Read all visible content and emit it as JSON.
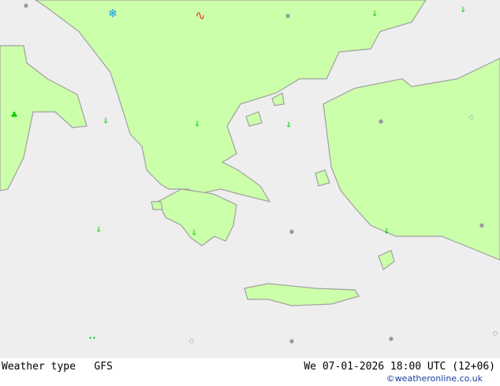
{
  "map": {
    "title": "Weather type",
    "model": "GFS",
    "datetime": "We 07-01-2026 18:00 UTC (12+06)",
    "credit": "©weatheronline.co.uk",
    "colors": {
      "sea": "#eeeeee",
      "land": "#ccffaa",
      "border": "#a0a0a0",
      "rain": "#00cc00",
      "snow": "#1199ee",
      "thunder_warm": "#ee3333",
      "cloud": "#999999"
    },
    "symbols": [
      {
        "type": "snow-icon",
        "glyph": "❄",
        "color": "#1199ee"
      },
      {
        "type": "frontal-wave-icon",
        "glyph": "∿",
        "color": "#ee3333"
      },
      {
        "type": "drizzle-icon",
        "glyph": "⇓",
        "color": "#00cc00"
      },
      {
        "type": "drizzle-icon",
        "glyph": "⇓",
        "color": "#00cc00"
      },
      {
        "type": "drizzle-icon",
        "glyph": "⇓",
        "color": "#00cc00"
      },
      {
        "type": "drizzle-icon",
        "glyph": "⇓",
        "color": "#00cc00"
      },
      {
        "type": "drizzle-icon",
        "glyph": "⇓",
        "color": "#00cc00"
      },
      {
        "type": "drizzle-icon",
        "glyph": "⇓",
        "color": "#00cc00"
      },
      {
        "type": "drizzle-icon",
        "glyph": "⇓",
        "color": "#00cc00"
      },
      {
        "type": "drizzle-icon",
        "glyph": "⇓",
        "color": "#00cc00"
      },
      {
        "type": "shower-icon",
        "glyph": "♣",
        "color": "#00cc00"
      },
      {
        "type": "light-rain-icon",
        "glyph": "••",
        "color": "#00cc00"
      },
      {
        "type": "cloud-icon",
        "glyph": "●",
        "color": "#999999"
      },
      {
        "type": "cloud-icon",
        "glyph": "●",
        "color": "#999999"
      },
      {
        "type": "cloud-icon",
        "glyph": "●",
        "color": "#999999"
      },
      {
        "type": "cloud-icon",
        "glyph": "○",
        "color": "#999999"
      },
      {
        "type": "cloud-icon",
        "glyph": "●",
        "color": "#999999"
      },
      {
        "type": "cloud-icon",
        "glyph": "●",
        "color": "#999999"
      },
      {
        "type": "cloud-icon",
        "glyph": "●",
        "color": "#999999"
      },
      {
        "type": "cloud-icon",
        "glyph": "●",
        "color": "#999999"
      },
      {
        "type": "cloud-icon",
        "glyph": "○",
        "color": "#999999"
      },
      {
        "type": "cloud-icon",
        "glyph": "○",
        "color": "#999999"
      }
    ]
  }
}
